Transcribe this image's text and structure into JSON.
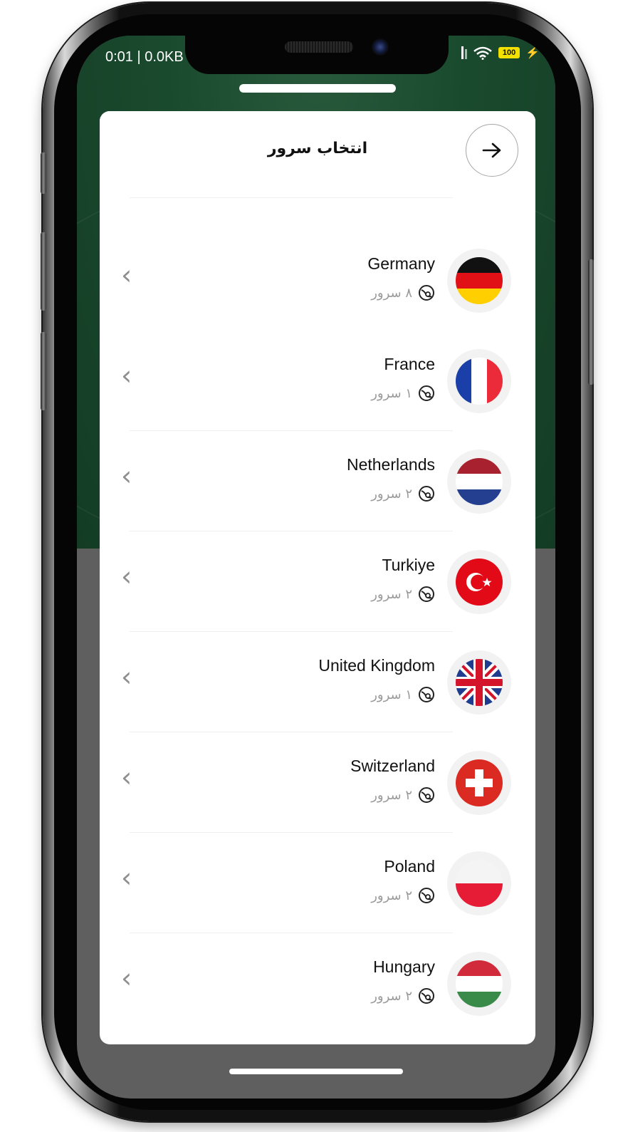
{
  "status_bar": {
    "left_text": "0:01 | 0.0KB",
    "battery": "100"
  },
  "header": {
    "title": "انتخاب سرور",
    "back_icon": "arrow-right-icon"
  },
  "colors": {
    "accent": "#1a4a2e",
    "surface": "#ffffff",
    "muted": "#9a9a9a"
  },
  "servers": [
    {
      "name": "Germany",
      "count": "۸ سرور"
    },
    {
      "name": "France",
      "count": "۱ سرور"
    },
    {
      "name": "Netherlands",
      "count": "۲ سرور"
    },
    {
      "name": "Turkiye",
      "count": "۲ سرور"
    },
    {
      "name": "United Kingdom",
      "count": "۱ سرور"
    },
    {
      "name": "Switzerland",
      "count": "۲ سرور"
    },
    {
      "name": "Poland",
      "count": "۲ سرور"
    },
    {
      "name": "Hungary",
      "count": "۲ سرور"
    }
  ]
}
